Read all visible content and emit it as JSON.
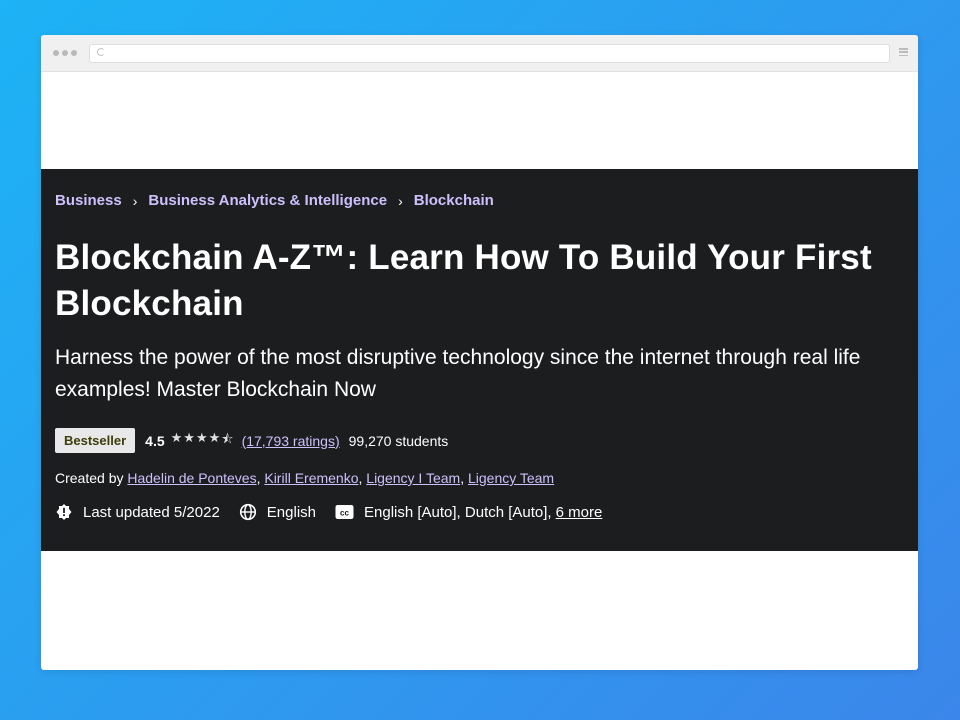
{
  "breadcrumb": [
    "Business",
    "Business Analytics & Intelligence",
    "Blockchain"
  ],
  "course": {
    "title": "Blockchain A-Z™: Learn How To Build Your First Blockchain",
    "headline": "Harness the power of the most disruptive technology since the internet through real life examples! Master Blockchain Now",
    "badge": "Bestseller",
    "rating": "4.5",
    "rating_stars": 4.5,
    "ratings_count": "(17,793 ratings)",
    "students": "99,270 students",
    "created_by_label": "Created by",
    "instructors": [
      "Hadelin de Ponteves",
      "Kirill Eremenko",
      "Ligency I Team",
      "Ligency Team"
    ],
    "last_updated": "Last updated 5/2022",
    "language": "English",
    "captions": "English [Auto], Dutch [Auto],",
    "captions_more": "6 more"
  },
  "icons": {
    "updated": "alert-badge-icon",
    "language": "globe-icon",
    "captions": "closed-captions-icon"
  },
  "colors": {
    "hero_background": "#1c1d1f",
    "link_purple": "#cec0fc",
    "page_gradient_start": "#1db3f5",
    "page_gradient_end": "#3b86ea"
  }
}
